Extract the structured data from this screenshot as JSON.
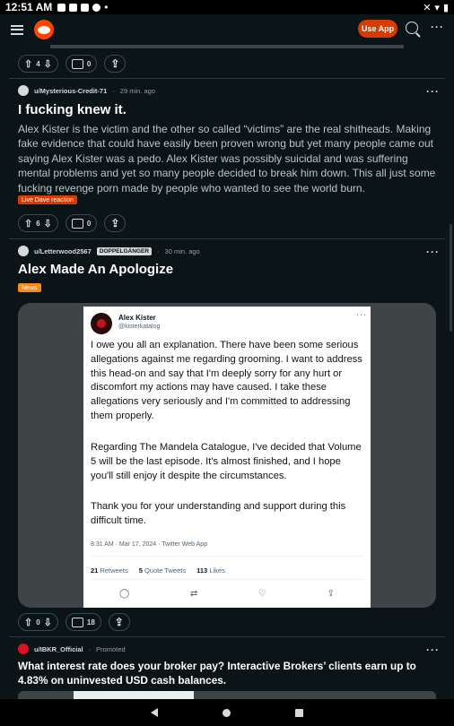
{
  "status_bar": {
    "time": "12:51 AM"
  },
  "header": {
    "use_app_label": "Use App"
  },
  "post_prev": {
    "votes": "4",
    "comments": "0"
  },
  "post1": {
    "username": "u/Mysterious-Credit-71",
    "time": "29 min. ago",
    "title": "I fucking knew it.",
    "body": "Alex Kister is the victim and the other so called “victims” are the real shitheads. Making fake evidence that could have easily been proven wrong but yet many people came out saying Alex Kister was a pedo. Alex Kister was possibly suicidal and was suffering mental problems and yet so many people decided to break him down. This all just some fucking revenge porn made by people who wanted to see the world burn.",
    "flair": "Live Dave reaction",
    "votes": "6",
    "comments": "0"
  },
  "post2": {
    "username": "u/Letterwood2567",
    "badge": "DOPPELGÄNGER",
    "time": "30 min. ago",
    "title": "Alex Made An Apologize",
    "flair": "News",
    "votes": "0",
    "comments": "18",
    "tweet": {
      "name": "Alex Kister",
      "handle": "@kisterkatalog",
      "para1": "I owe you all an explanation. There have been some serious allegations against me regarding grooming. I want to address this head-on and say that I'm deeply sorry for any hurt or discomfort my actions may have caused. I take these allegations very seriously and I'm committed to addressing them properly.",
      "para2": "Regarding The Mandela Catalogue, I've decided that Volume 5 will be the last episode. It's almost finished, and I hope you'll still enjoy it despite the circumstances.",
      "para3": "Thank you for your understanding and support during this difficult time.",
      "date": "8:31 AM · Mar 17, 2024 · Twitter Web App",
      "retweets": "21",
      "retweets_label": "Retweets",
      "quotes": "5",
      "quotes_label": "Quote Tweets",
      "likes": "113",
      "likes_label": "Likes"
    }
  },
  "promo": {
    "username": "u/IBKR_Official",
    "tag": "Promoted",
    "title": "What interest rate does your broker pay? Interactive Brokers’ clients earn up to 4.83% on uninvested USD cash balances."
  },
  "colors": {
    "accent": "#d93a00",
    "flair_live": "#d93a00",
    "flair_news": "#ff8717",
    "background": "#0b1416"
  },
  "icons": [
    "menu-icon",
    "reddit-logo",
    "search-icon",
    "upvote-icon",
    "downvote-icon",
    "comment-icon",
    "share-icon",
    "overflow-dots-icon"
  ]
}
